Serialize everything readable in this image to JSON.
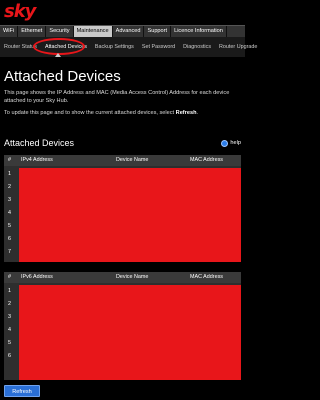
{
  "brand": {
    "logo": "sky",
    "color": "#e8161a"
  },
  "main_nav": [
    {
      "label": "WiFi"
    },
    {
      "label": "Ethernet"
    },
    {
      "label": "Security"
    },
    {
      "label": "Maintenance",
      "active": true
    },
    {
      "label": "Advanced"
    },
    {
      "label": "Support"
    },
    {
      "label": "Licence Information"
    }
  ],
  "sub_nav": [
    {
      "label": "Router Status"
    },
    {
      "label": "Attached Devices",
      "active": true
    },
    {
      "label": "Backup Settings"
    },
    {
      "label": "Set Password"
    },
    {
      "label": "Diagnostics"
    },
    {
      "label": "Router Upgrade"
    }
  ],
  "page": {
    "title": "Attached Devices",
    "description": "This page shows the IP Address and MAC (Media Access Control) Address for each device attached to your Sky Hub.",
    "update_prefix": "To update this page and to show the current attached devices, select ",
    "update_action": "Refresh",
    "update_suffix": "."
  },
  "section": {
    "title": "Attached Devices",
    "help_label": "help"
  },
  "ipv4_table": {
    "headers": [
      "#",
      "IPv4 Address",
      "Device Name",
      "MAC Address"
    ],
    "rows": [
      "1",
      "2",
      "3",
      "4",
      "5",
      "6",
      "7"
    ]
  },
  "ipv6_table": {
    "headers": [
      "#",
      "IPv6 Address",
      "Device Name",
      "MAC Address"
    ],
    "rows": [
      "1",
      "2",
      "3",
      "4",
      "5",
      "6"
    ]
  },
  "refresh_button": {
    "label": "Refresh"
  },
  "colors": {
    "accent": "#e8161a",
    "button": "#2a6fd6",
    "background": "#000000"
  }
}
